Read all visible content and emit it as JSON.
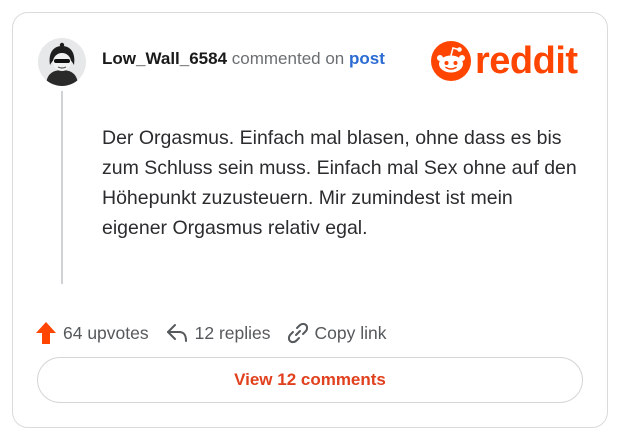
{
  "comment": {
    "username": "Low_Wall_6584",
    "commented_on": "commented on",
    "post_link": "post",
    "body": "Der Orgasmus. Einfach mal blasen, ohne dass es bis zum Schluss sein muss. Einfach mal Sex ohne auf den Höhepunkt zuzusteuern. Mir zumindest ist mein eigener Orgasmus relativ egal."
  },
  "brand": {
    "wordmark": "reddit",
    "color": "#ff4500"
  },
  "actions": {
    "upvotes": "64 upvotes",
    "replies": "12 replies",
    "copy_link": "Copy link"
  },
  "view_comments": "View 12 comments",
  "icons": [
    "avatar",
    "reddit-snoo-icon",
    "upvote-arrow-icon",
    "reply-icon",
    "link-icon"
  ]
}
